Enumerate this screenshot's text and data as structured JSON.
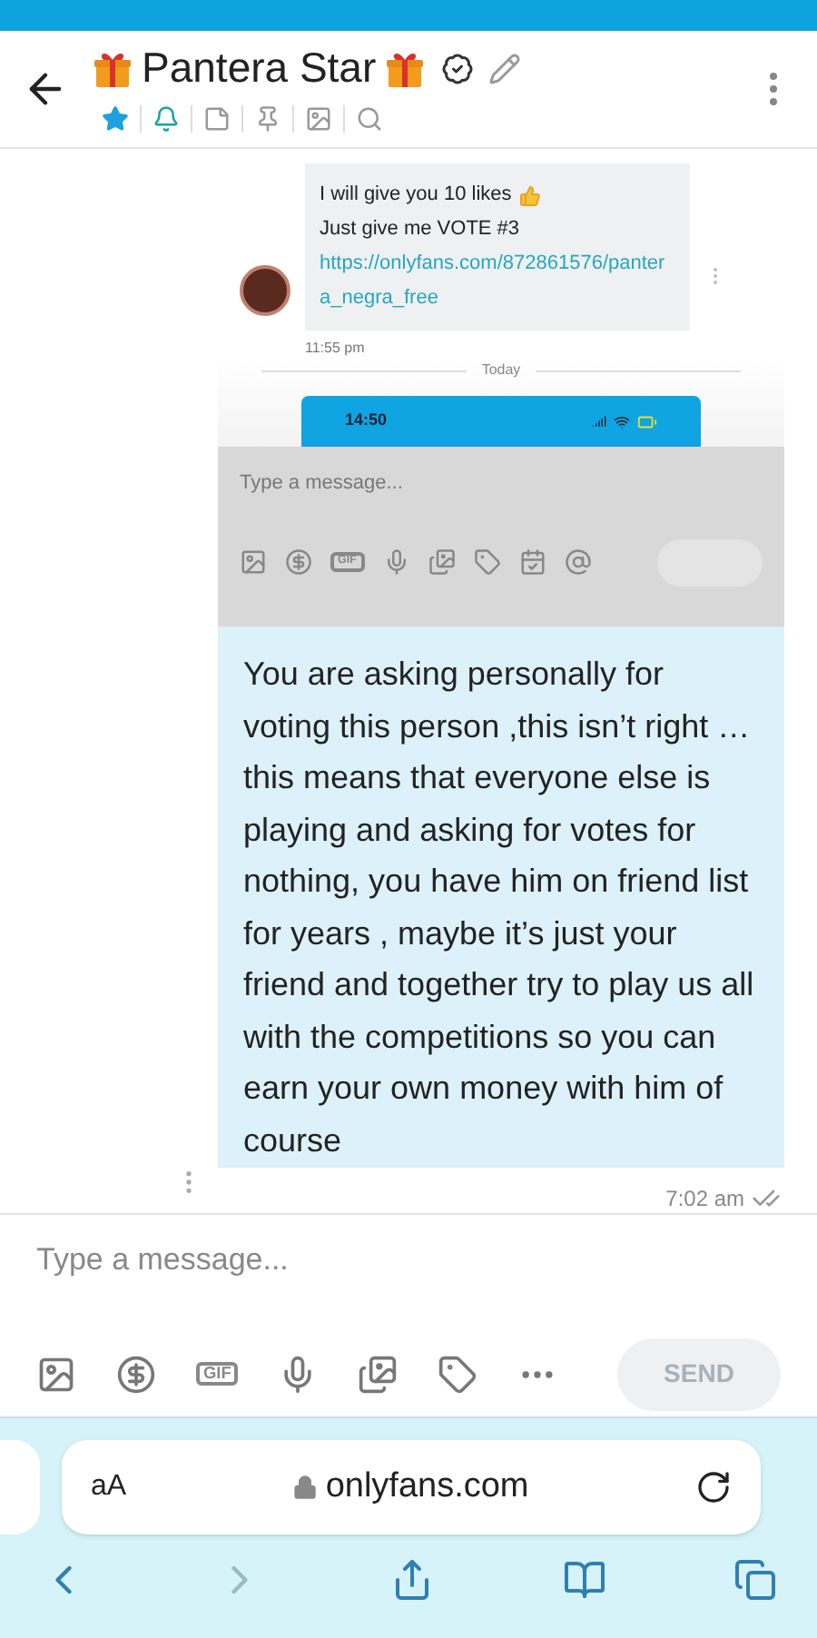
{
  "header": {
    "title": "Pantera Star",
    "verified": true,
    "actions": [
      {
        "kind": "star",
        "on": true
      },
      {
        "kind": "bell",
        "on": true
      },
      {
        "kind": "note",
        "on": false
      },
      {
        "kind": "pin",
        "on": false
      },
      {
        "kind": "image",
        "on": false
      },
      {
        "kind": "search",
        "on": false
      }
    ]
  },
  "attachment": {
    "kind": "screenshot",
    "message": {
      "lines": [
        "I will give you 10 likes",
        "Just give me VOTE #3"
      ],
      "link": "https://onlyfans.com/872861576/pantera_negra_free",
      "time": "11:55 pm"
    },
    "divider": "Today",
    "clock": "14:50",
    "placeholder": "Type a message...",
    "tools": [
      {
        "kind": "image"
      },
      {
        "kind": "tip"
      },
      {
        "kind": "gif",
        "label": "GIF"
      },
      {
        "kind": "mic"
      },
      {
        "kind": "media"
      },
      {
        "kind": "price"
      },
      {
        "kind": "calendar"
      },
      {
        "kind": "at"
      }
    ]
  },
  "message": {
    "text": "You are asking personally for voting this person ,this isn’t right … this means that everyone else is playing and asking for votes for nothing, you have him on friend list for years , maybe it’s just your friend and together try to play us all with the competitions so you can earn your own money with him of course",
    "time": "7:02 am",
    "read": true
  },
  "composer": {
    "placeholder": "Type a message...",
    "tools": [
      {
        "kind": "image"
      },
      {
        "kind": "tip"
      },
      {
        "kind": "gif",
        "label": "GIF"
      },
      {
        "kind": "mic"
      },
      {
        "kind": "media"
      },
      {
        "kind": "price"
      },
      {
        "kind": "more"
      }
    ],
    "send": {
      "label": "SEND",
      "disabled": true
    }
  },
  "browser": {
    "text_size": "aA",
    "address": "onlyfans.com",
    "back_enabled": true,
    "forward_enabled": false
  }
}
